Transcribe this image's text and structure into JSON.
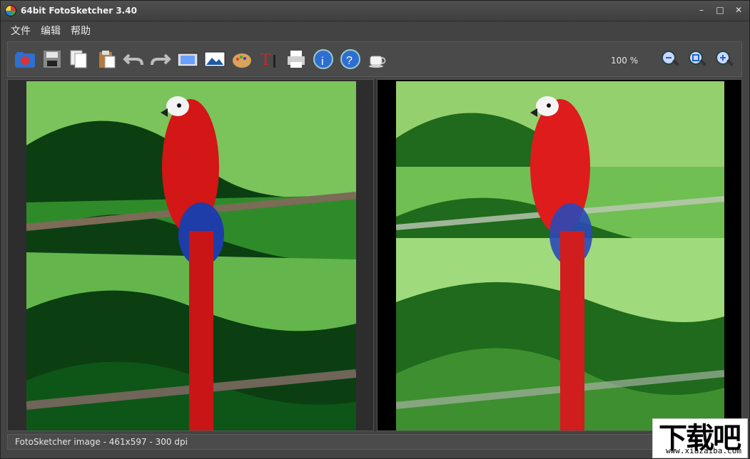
{
  "window": {
    "title": "64bit FotoSketcher 3.40"
  },
  "menu": {
    "items": [
      "文件",
      "编辑",
      "帮助"
    ]
  },
  "toolbar": {
    "icons": [
      "open-folder-icon",
      "save-icon",
      "copy-icon",
      "paste-icon",
      "undo-icon",
      "redo-icon",
      "film-strip-icon",
      "image-icon",
      "palette-icon",
      "text-tool-icon",
      "print-icon",
      "info-icon",
      "help-icon",
      "coffee-cup-icon",
      "zoom-out-icon",
      "zoom-fit-icon",
      "zoom-in-icon"
    ],
    "zoom_level": "100 %"
  },
  "status": {
    "text": "FotoSketcher image - 461x597 - 300 dpi"
  },
  "watermark": {
    "main": "下载吧",
    "sub": "www.xiazaiba.com"
  },
  "colors": {
    "window_bg": "#444444",
    "panel_bg": "#2d2d2d",
    "accent_blue": "#1e63c7"
  }
}
